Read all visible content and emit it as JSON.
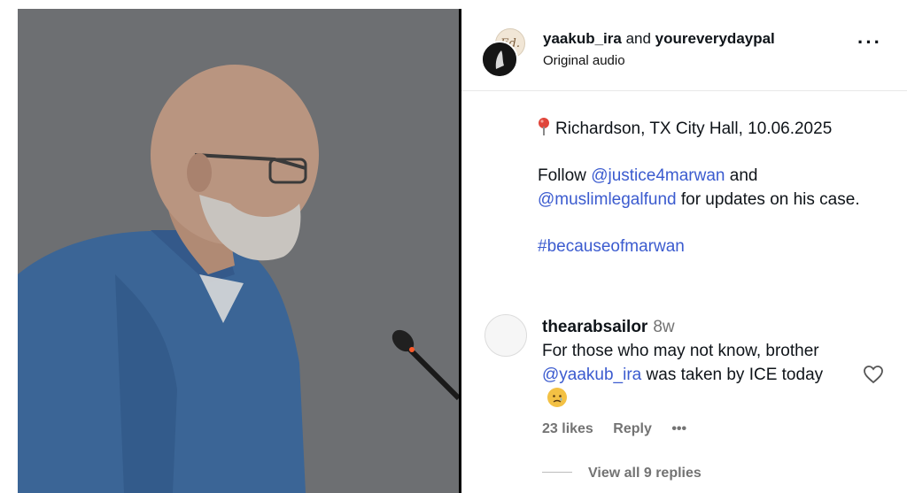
{
  "post": {
    "authors": {
      "primary": "yaakub_ira",
      "joiner": " and ",
      "secondary": "youreverydaypal"
    },
    "audio": "Original audio",
    "more_icon": "more-horizontal-icon",
    "secondary_avatar_text": "Ed."
  },
  "caption": {
    "location_icon": "map-pin-icon",
    "location": "Richardson, TX City Hall, 10.06.2025",
    "follow_prefix": "Follow ",
    "mention1": "@justice4marwan",
    "and": " and ",
    "mention2": "@muslimlegalfund",
    "follow_suffix": " for updates on his case.",
    "hashtag": "#becauseofmarwan"
  },
  "comment": {
    "username": "thearabsailor",
    "time": "8w",
    "text_prefix": "For those who may not know, brother ",
    "mention": "@yaakub_ira",
    "text_suffix": " was taken by ICE today",
    "emoji_icon": "sad-face-emoji",
    "likes": "23 likes",
    "reply": "Reply",
    "more": "•••",
    "view_replies": "View all 9 replies",
    "like_icon": "heart-outline-icon"
  },
  "colors": {
    "link": "#3b5bcf",
    "muted": "#737373",
    "shirt": "#3b6596",
    "background_media": "#6e7073"
  }
}
